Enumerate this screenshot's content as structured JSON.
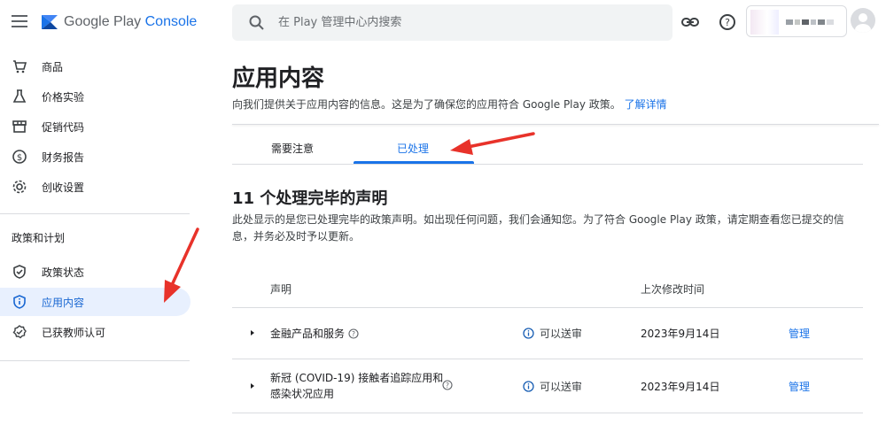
{
  "app": {
    "brand_main": "Google Play",
    "brand_console": "Console"
  },
  "search": {
    "placeholder": "在 Play 管理中心内搜索"
  },
  "icons": {
    "menu": "hamburger-icon",
    "logo": "play-console-logo",
    "search": "search-icon",
    "link": "link-icon",
    "help": "help-icon",
    "avatar": "account-avatar"
  },
  "sidebar": {
    "items": [
      {
        "label": "商品",
        "icon": "cart-icon"
      },
      {
        "label": "价格实验",
        "icon": "flask-icon"
      },
      {
        "label": "促销代码",
        "icon": "store-icon"
      },
      {
        "label": "财务报告",
        "icon": "dollar-icon"
      },
      {
        "label": "创收设置",
        "icon": "gear-icon"
      }
    ],
    "section_title": "政策和计划",
    "policy_items": [
      {
        "label": "政策状态",
        "icon": "shield-check-icon"
      },
      {
        "label": "应用内容",
        "icon": "info-shield-icon",
        "active": true
      },
      {
        "label": "已获教师认可",
        "icon": "badge-check-icon"
      }
    ]
  },
  "main": {
    "title": "应用内容",
    "description": "向我们提供关于应用内容的信息。这是为了确保您的应用符合 Google Play 政策。",
    "learn_more": "了解详情",
    "tabs": [
      {
        "label": "需要注意",
        "active": false
      },
      {
        "label": "已处理",
        "active": true
      }
    ],
    "section_heading": "11 个处理完毕的声明",
    "section_desc": "此处显示的是您已处理完毕的政策声明。如出现任何问题，我们会通知您。为了符合 Google Play 政策，请定期查看您已提交的信息，并务必及时予以更新。",
    "table": {
      "headers": [
        "声明",
        "上次修改时间"
      ],
      "rows": [
        {
          "declaration": "金融产品和服务",
          "status": "可以送审",
          "modified": "2023年9月14日",
          "action": "管理"
        },
        {
          "declaration_line1": "新冠 (COVID-19) 接触者追踪应用和",
          "declaration_line2": "感染状况应用",
          "status": "可以送审",
          "modified": "2023年9月14日",
          "action": "管理"
        }
      ]
    }
  },
  "colors": {
    "accent": "#1a73e8",
    "arrow": "#e8322a",
    "active_bg": "#e8f0fe"
  }
}
